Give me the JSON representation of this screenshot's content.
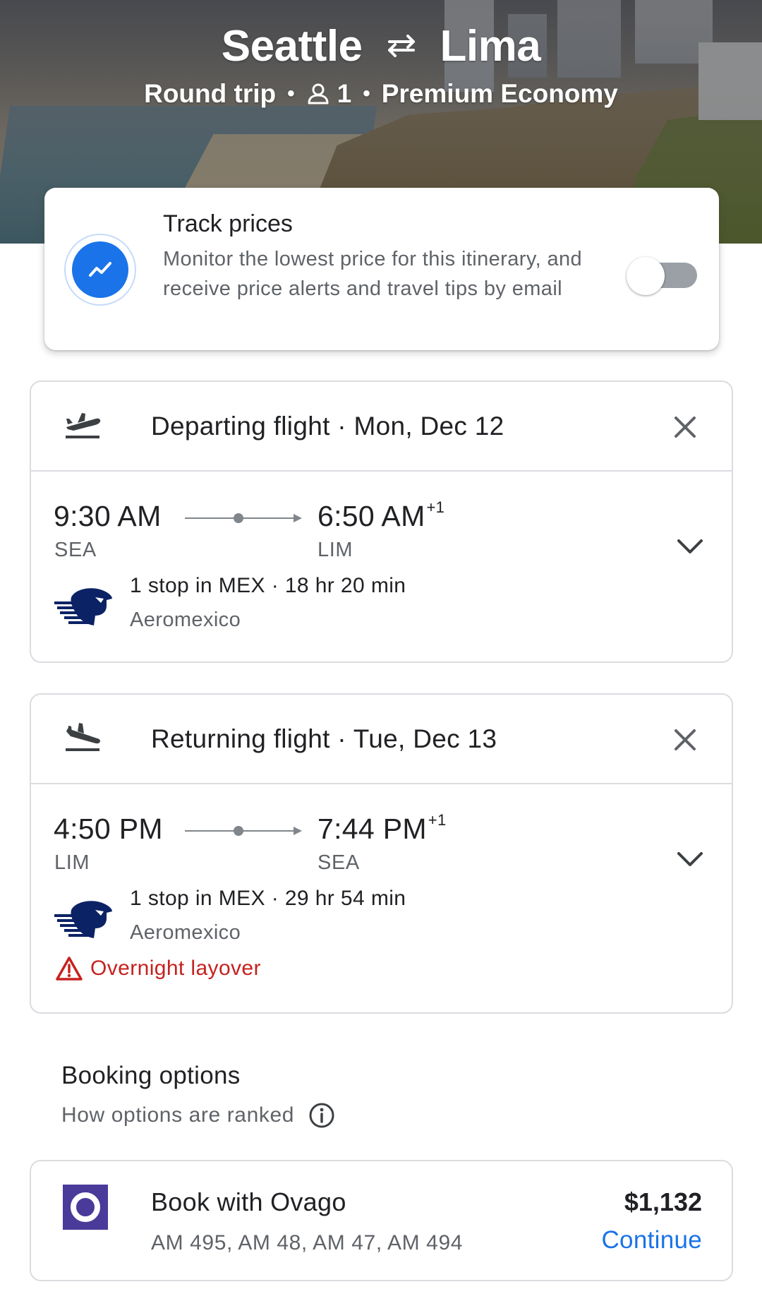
{
  "hero": {
    "origin": "Seattle",
    "destination": "Lima",
    "trip_type": "Round trip",
    "passengers": "1",
    "cabin_class": "Premium Economy"
  },
  "track_prices": {
    "title": "Track prices",
    "description": "Monitor the lowest price for this itinerary, and receive price alerts and travel tips by email",
    "enabled": false
  },
  "departing": {
    "title": "Departing flight · Mon, Dec 12",
    "depart_time": "9:30 AM",
    "arrive_time": "6:50 AM",
    "arrive_offset": "+1",
    "from_code": "SEA",
    "to_code": "LIM",
    "stops": "1 stop in MEX · 18 hr 20 min",
    "airline": "Aeromexico"
  },
  "returning": {
    "title": "Returning flight · Tue, Dec 13",
    "depart_time": "4:50 PM",
    "arrive_time": "7:44 PM",
    "arrive_offset": "+1",
    "from_code": "LIM",
    "to_code": "SEA",
    "stops": "1 stop in MEX · 29 hr 54 min",
    "airline": "Aeromexico",
    "warning": "Overnight layover"
  },
  "booking": {
    "title": "Booking options",
    "ranked_label": "How options are ranked",
    "options": [
      {
        "name": "Book with Ovago",
        "flights": "AM 495, AM 48, AM 47, AM 494",
        "price": "$1,132",
        "action": "Continue"
      }
    ]
  },
  "colors": {
    "accent": "#1a73e8",
    "warning": "#c5221f",
    "ovago": "#4a3a9a"
  }
}
